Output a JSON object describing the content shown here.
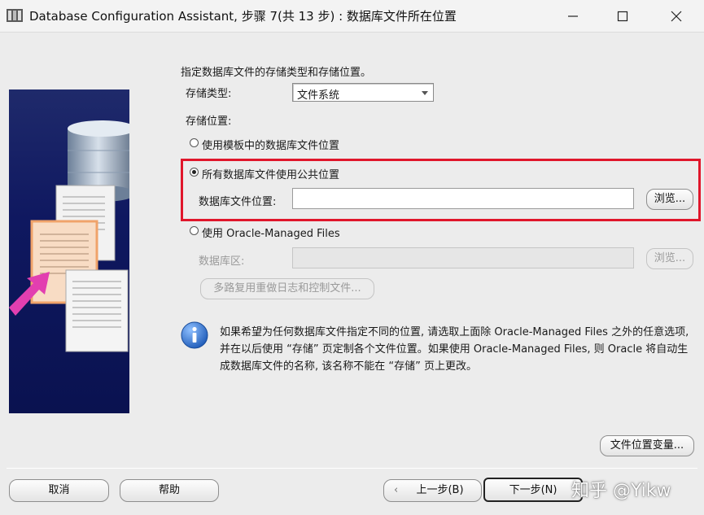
{
  "window": {
    "title": "Database Configuration Assistant, 步骤 7(共 13 步) : 数据库文件所在位置"
  },
  "main": {
    "intro": "指定数据库文件的存储类型和存储位置。",
    "storage_type_label": "存储类型:",
    "storage_type_value": "文件系统",
    "storage_location_label": "存储位置:",
    "options": [
      {
        "label": "使用模板中的数据库文件位置",
        "selected": false
      },
      {
        "label": "所有数据库文件使用公共位置",
        "selected": true
      },
      {
        "label": "使用 Oracle-Managed Files",
        "selected": false
      }
    ],
    "db_file_location_label": "数据库文件位置:",
    "db_file_location_value": "",
    "browse_label": "浏览...",
    "db_area_label": "数据库区:",
    "db_area_value": "",
    "browse2_label": "浏览...",
    "multiplex_label": "多路复用重做日志和控制文件...",
    "info_text": "如果希望为任何数据库文件指定不同的位置, 请选取上面除 Oracle-Managed Files 之外的任意选项, 并在以后使用 “存储” 页定制各个文件位置。如果使用 Oracle-Managed Files, 则 Oracle 将自动生成数据库文件的名称, 该名称不能在 “存储” 页上更改。",
    "file_location_vars_label": "文件位置变量..."
  },
  "footer": {
    "cancel_label": "取消",
    "help_label": "帮助",
    "back_label": "上一步(B)",
    "next_label": "下一步(N)"
  },
  "watermark": "知乎 @Yikw",
  "colors": {
    "highlight": "#e0162b",
    "side_panel": "#0f1860",
    "info_icon": "#1e5bb8"
  }
}
